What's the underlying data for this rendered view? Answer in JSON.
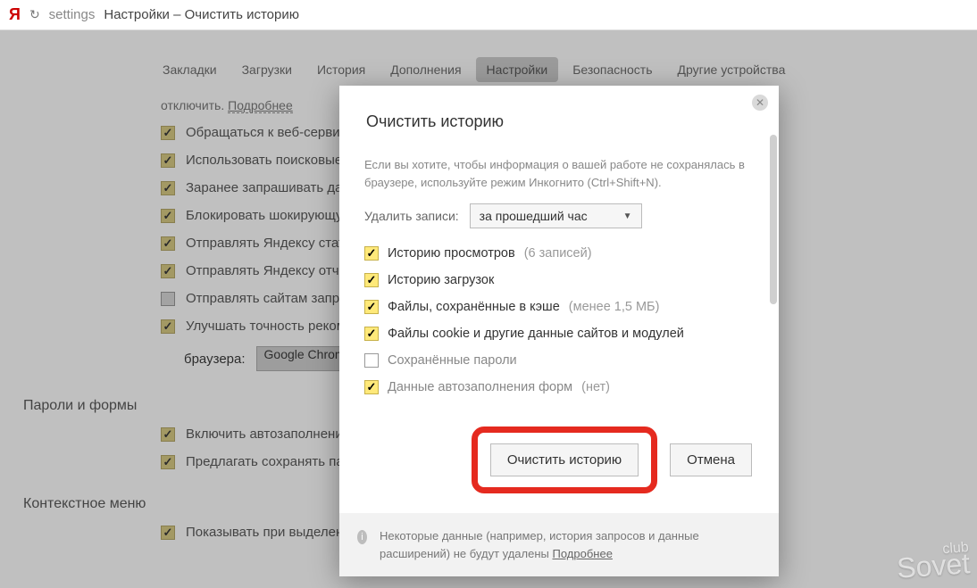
{
  "addressbar": {
    "logo": "Я",
    "settings_word": "settings",
    "title": "Настройки – Очистить историю"
  },
  "tabs": {
    "items": [
      {
        "label": "Закладки"
      },
      {
        "label": "Загрузки"
      },
      {
        "label": "История"
      },
      {
        "label": "Дополнения"
      },
      {
        "label": "Настройки",
        "active": true
      },
      {
        "label": "Безопасность"
      },
      {
        "label": "Другие устройства"
      }
    ]
  },
  "bg_settings": {
    "note_prefix": "отключить.",
    "note_link": "Подробнее",
    "options": [
      {
        "checked": true,
        "label": "Обращаться к веб-серви"
      },
      {
        "checked": true,
        "label": "Использовать поисковые"
      },
      {
        "checked": true,
        "label": "Заранее запрашивать да"
      },
      {
        "checked": true,
        "label": "Блокировать шокирующу"
      },
      {
        "checked": true,
        "label": "Отправлять Яндексу стати"
      },
      {
        "checked": true,
        "label": "Отправлять Яндексу отчё"
      },
      {
        "checked": false,
        "label": "Отправлять сайтам запро"
      },
      {
        "checked": true,
        "label": "Улучшать точность реком"
      }
    ],
    "browser_row": {
      "label": "браузера:",
      "value": "Google Chrom"
    },
    "section2": "Пароли и формы",
    "s2_options": [
      {
        "checked": true,
        "label": "Включить автозаполнени"
      },
      {
        "checked": true,
        "label": "Предлагать сохранять пар"
      }
    ],
    "section3": "Контекстное меню",
    "s3_options": [
      {
        "checked": true,
        "label": "Показывать при выделении текста кнопки «Найти» и «Копировать»"
      }
    ]
  },
  "dialog": {
    "title": "Очистить историю",
    "note": "Если вы хотите, чтобы информация о вашей работе не сохранялась в браузере, используйте режим Инкогнито (Ctrl+Shift+N).",
    "delete_label": "Удалить записи:",
    "period_value": "за прошедший час",
    "checks": [
      {
        "checked": true,
        "label": "Историю просмотров",
        "hint": "(6 записей)"
      },
      {
        "checked": true,
        "label": "Историю загрузок",
        "hint": ""
      },
      {
        "checked": true,
        "label": "Файлы, сохранённые в кэше",
        "hint": "(менее 1,5 МБ)"
      },
      {
        "checked": true,
        "label": "Файлы cookie и другие данные сайтов и модулей",
        "hint": ""
      },
      {
        "checked": false,
        "label": "Сохранённые пароли",
        "hint": ""
      },
      {
        "checked": true,
        "label": "Данные автозаполнения форм",
        "hint": "(нет)"
      }
    ],
    "primary": "Очистить историю",
    "cancel": "Отмена",
    "footer_text": "Некоторые данные (например, история запросов и данные расширений) не будут удалены",
    "footer_more": "Подробнее"
  },
  "watermark": {
    "top": "club",
    "main": "Sovet"
  }
}
